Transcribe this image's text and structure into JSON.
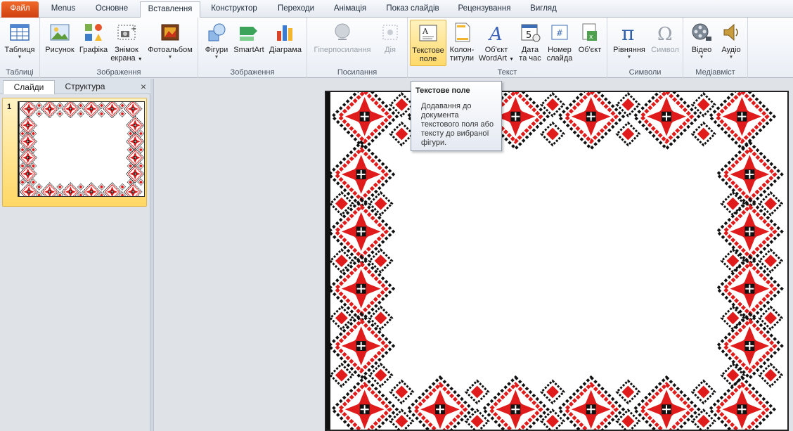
{
  "tabs": {
    "file": "Файл",
    "menus": "Menus",
    "home": "Основне",
    "insert": "Вставлення",
    "design": "Конструктор",
    "transitions": "Переходи",
    "animation": "Анімація",
    "slideshow": "Показ слайдів",
    "review": "Рецензування",
    "view": "Вигляд"
  },
  "ribbon": {
    "tables": {
      "label": "Таблиці",
      "table": "Таблиця"
    },
    "images": {
      "label": "Зображення",
      "picture": "Рисунок",
      "clipart": "Графіка",
      "screenshot_1": "Знімок",
      "screenshot_2": "екрана",
      "album": "Фотоальбом"
    },
    "illustrations": {
      "label": "Зображення",
      "shapes": "Фігури",
      "smartart": "SmartArt",
      "chart": "Діаграма"
    },
    "links": {
      "label": "Посилання",
      "hyperlink": "Гіперпосилання",
      "action": "Дія"
    },
    "text": {
      "label": "Текст",
      "textbox_1": "Текстове",
      "textbox_2": "поле",
      "header_1": "Колон-",
      "header_2": "титули",
      "wordart_1": "Об'єкт",
      "wordart_2": "WordArt",
      "datetime_1": "Дата",
      "datetime_2": "та час",
      "slidenum_1": "Номер",
      "slidenum_2": "слайда",
      "object": "Об'єкт"
    },
    "symbols": {
      "label": "Символи",
      "equation": "Рівняння",
      "symbol": "Символ"
    },
    "media": {
      "label": "Медіавміст",
      "video": "Відео",
      "audio": "Аудіо"
    }
  },
  "left_panel": {
    "slides_tab": "Слайди",
    "outline_tab": "Структура",
    "close": "×",
    "slide_number": "1"
  },
  "tooltip": {
    "title": "Текстове поле",
    "body": "Додавання до документа текстового поля або тексту до вибраної фігури."
  },
  "colors": {
    "accent_file": "#e2531c",
    "embroidery_red": "#e01b1b",
    "embroidery_black": "#111111",
    "selection": "#ffd96a"
  }
}
